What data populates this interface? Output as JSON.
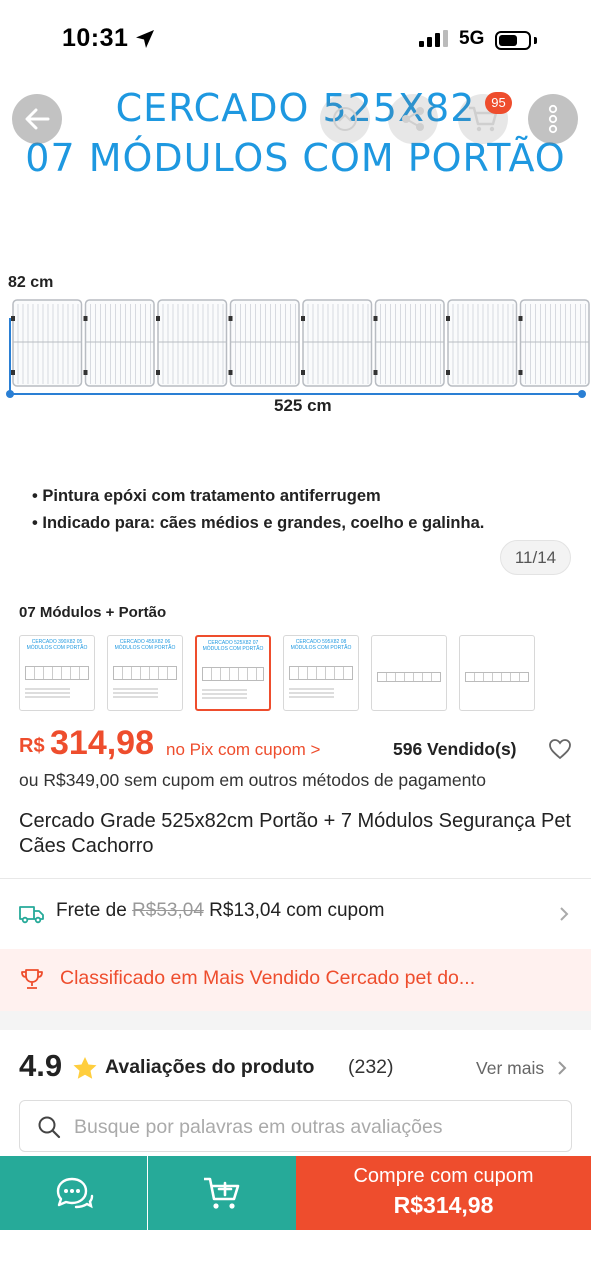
{
  "status_bar": {
    "time": "10:31",
    "network": "5G"
  },
  "product_image": {
    "title_line1": "CERCADO 525X82",
    "title_line2": "07 MÓDULOS COM PORTÃO",
    "height_label": "82 cm",
    "width_label": "525 cm",
    "bullets": [
      "Pintura epóxi com tratamento antiferrugem",
      "Indicado para: cães médios e grandes, coelho e galinha."
    ],
    "counter": "11/14"
  },
  "cart": {
    "badge_count": "95"
  },
  "variants": {
    "selected_label": "07 Módulos + Portão",
    "thumbnails": [
      {
        "caption": "CERCADO 390X82 05 MÓDULOS COM PORTÃO",
        "selected": false
      },
      {
        "caption": "CERCADO 455X82 06 MÓDULOS COM PORTÃO",
        "selected": false
      },
      {
        "caption": "CERCADO 525X82 07 MÓDULOS COM PORTÃO",
        "selected": true
      },
      {
        "caption": "CERCADO 595X82 08 MÓDULOS COM PORTÃO",
        "selected": false
      },
      {
        "caption": "",
        "selected": false
      },
      {
        "caption": "",
        "selected": false
      }
    ]
  },
  "price": {
    "currency": "R$",
    "value": "314,98",
    "pix_label": "no Pix com cupom >",
    "sold": "596 Vendido(s)",
    "alt_price": "ou R$349,00 sem cupom em outros métodos de pagamento"
  },
  "product": {
    "title": "Cercado Grade 525x82cm Portão + 7 Módulos Segurança Pet Cães Cachorro"
  },
  "shipping": {
    "prefix": "Frete de",
    "old_price": "R$53,04",
    "new_price": "R$13,04 com cupom"
  },
  "ranking": {
    "text": "Classificado em Mais Vendido Cercado pet do..."
  },
  "reviews": {
    "rating": "4.9",
    "label": "Avaliações do produto",
    "count": "(232)",
    "see_more": "Ver mais",
    "search_placeholder": "Busque por palavras em outras avaliações"
  },
  "bottom_bar": {
    "buy_label": "Compre com cupom",
    "buy_price": "R$314,98"
  },
  "colors": {
    "accent": "#ee4d2d",
    "teal": "#26aa99",
    "image_title": "#1e98e0"
  }
}
